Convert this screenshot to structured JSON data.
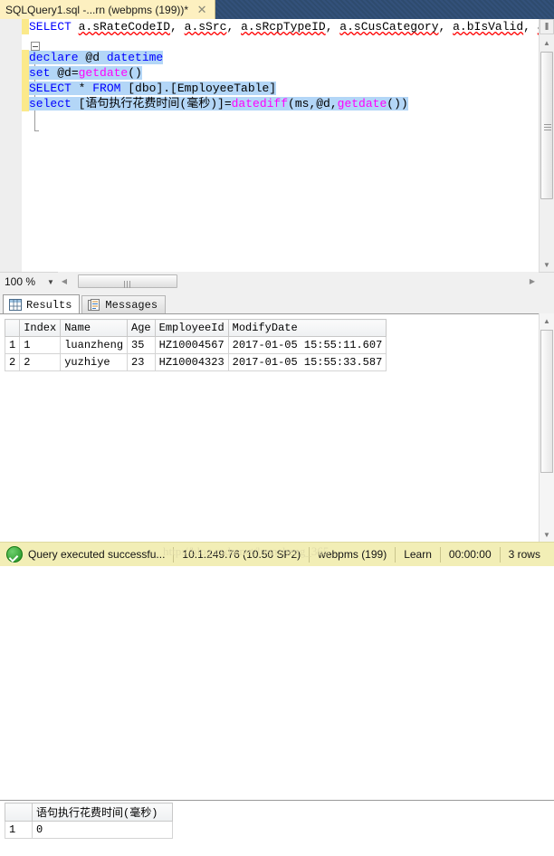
{
  "window": {
    "tab": {
      "title": "SQLQuery1.sql -...rn (webpms (199))*",
      "close_icon": "close-icon"
    }
  },
  "editor": {
    "zoom_level": "100 %",
    "outline_icon": "collapse-minus-icon",
    "lines": [
      {
        "segments": [
          {
            "text": "SELECT ",
            "type": "keyword"
          },
          {
            "text": "a.sRateCodeID",
            "type": "squiggle"
          },
          {
            "text": ", ",
            "type": "plain"
          },
          {
            "text": "a.sSrc",
            "type": "squiggle"
          },
          {
            "text": ", ",
            "type": "plain"
          },
          {
            "text": "a.sRcpTypeID",
            "type": "squiggle"
          },
          {
            "text": ", ",
            "type": "plain"
          },
          {
            "text": "a.sCusCategory",
            "type": "squiggle"
          },
          {
            "text": ", ",
            "type": "plain"
          },
          {
            "text": "a.bIsValid",
            "type": "squiggle"
          },
          {
            "text": ", ",
            "type": "plain"
          },
          {
            "text": "a.sMemL",
            "type": "squiggle"
          }
        ]
      },
      {
        "segments": []
      },
      {
        "selected": true,
        "segments": [
          {
            "text": "declare ",
            "type": "keyword"
          },
          {
            "text": "@d ",
            "type": "plain"
          },
          {
            "text": "datetime",
            "type": "keyword"
          }
        ]
      },
      {
        "selected": true,
        "segments": [
          {
            "text": "set ",
            "type": "keyword"
          },
          {
            "text": "@d=",
            "type": "plain"
          },
          {
            "text": "getdate",
            "type": "function"
          },
          {
            "text": "()",
            "type": "plain"
          }
        ]
      },
      {
        "selected": true,
        "segments": [
          {
            "text": "SELECT ",
            "type": "keyword"
          },
          {
            "text": "* ",
            "type": "plain"
          },
          {
            "text": "FROM ",
            "type": "keyword"
          },
          {
            "text": "[dbo].[EmployeeTable]",
            "type": "plain"
          }
        ]
      },
      {
        "selected": true,
        "segments": [
          {
            "text": "select ",
            "type": "keyword"
          },
          {
            "text": "[语句执行花费时间(毫秒)]=",
            "type": "plain"
          },
          {
            "text": "datediff",
            "type": "function"
          },
          {
            "text": "(ms,@d,",
            "type": "plain"
          },
          {
            "text": "getdate",
            "type": "function"
          },
          {
            "text": "())",
            "type": "plain"
          }
        ]
      }
    ]
  },
  "results": {
    "tabs": [
      {
        "label": "Results",
        "icon": "grid-icon",
        "active": true
      },
      {
        "label": "Messages",
        "icon": "messages-icon",
        "active": false
      }
    ],
    "grid1": {
      "columns": [
        "Index",
        "Name",
        "Age",
        "EmployeeId",
        "ModifyDate"
      ],
      "rows": [
        {
          "num": "1",
          "cells": [
            "1",
            "luanzheng",
            "35",
            "HZ10004567",
            "2017-01-05 15:55:11.607"
          ],
          "selected_cell": 0
        },
        {
          "num": "2",
          "cells": [
            "2",
            "yuzhiye",
            "23",
            "HZ10004323",
            "2017-01-05 15:55:33.587"
          ]
        }
      ]
    },
    "grid2": {
      "columns": [
        "语句执行花费时间(毫秒)"
      ],
      "rows": [
        {
          "num": "1",
          "cells": [
            "0"
          ],
          "selected_cell": 0
        }
      ]
    }
  },
  "statusbar": {
    "status_icon": "success-check-icon",
    "message": "Query executed successfu...",
    "server": "10.1.249.76 (10.50 SP2)",
    "database": "webpms (199)",
    "user": "Learn",
    "elapsed": "00:00:00",
    "rows": "3 rows"
  },
  "watermark": "http://blog.csdn.net/luanzheng_365",
  "colors": {
    "tab_background": "#fdf0c0",
    "titlebar": "#2e4b6e",
    "keyword": "#0000ff",
    "function": "#ff00ff",
    "selection": "#b3d6f7",
    "changebar": "#fbe98a",
    "statusbar": "#f2eeb6",
    "success": "#1e8f1e"
  }
}
